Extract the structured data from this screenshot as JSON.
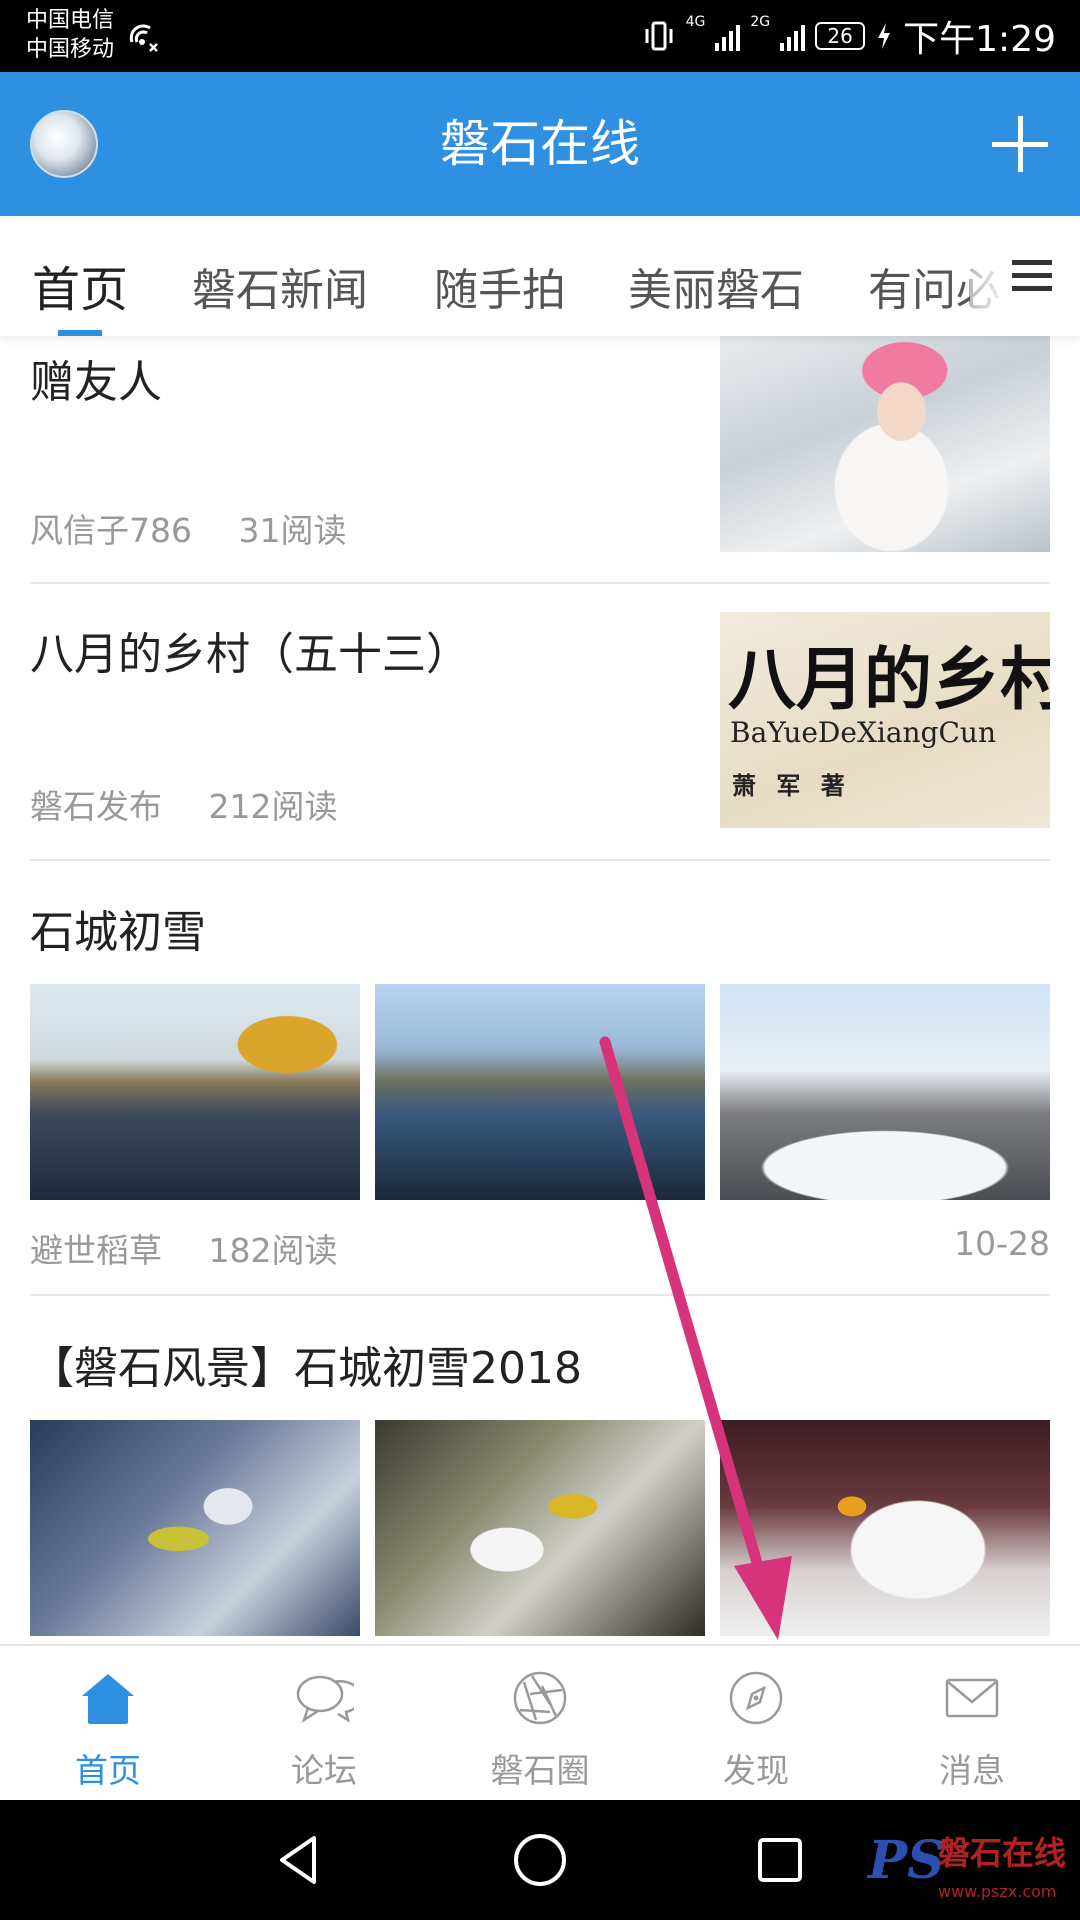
{
  "status_bar": {
    "carrier_1": "中国电信",
    "carrier_2": "中国移动",
    "network_1": "4G",
    "network_2": "2G",
    "battery": "26",
    "time": "下午1:29"
  },
  "header": {
    "title": "磐石在线"
  },
  "tabs": [
    {
      "label": "首页",
      "active": true
    },
    {
      "label": "磐石新闻",
      "active": false
    },
    {
      "label": "随手拍",
      "active": false
    },
    {
      "label": "美丽磐石",
      "active": false
    },
    {
      "label": "有问必",
      "active": false
    }
  ],
  "feed": {
    "items": [
      {
        "title": "赠友人",
        "author": "风信子786",
        "reads": "31阅读"
      },
      {
        "title": "八月的乡村（五十三）",
        "author": "磐石发布",
        "reads": "212阅读",
        "thumb_text": {
          "big": "八月的乡村",
          "pinyin": "BaYueDeXiangCun",
          "author": "萧 军 著"
        }
      },
      {
        "title": "石城初雪",
        "author": "避世稻草",
        "reads": "182阅读",
        "date": "10-28"
      },
      {
        "title": "【磐石风景】石城初雪2018"
      }
    ]
  },
  "bottom_nav": [
    {
      "label": "首页",
      "icon": "home-icon",
      "active": true
    },
    {
      "label": "论坛",
      "icon": "chat-icon",
      "active": false
    },
    {
      "label": "磐石圈",
      "icon": "aperture-icon",
      "active": false
    },
    {
      "label": "发现",
      "icon": "compass-icon",
      "active": false
    },
    {
      "label": "消息",
      "icon": "mail-icon",
      "active": false
    }
  ],
  "watermark": {
    "logo": "PS",
    "name": "磐石在线",
    "url": "www.pszx.com"
  },
  "colors": {
    "brand": "#2f8fe0",
    "annotation_arrow": "#d6337a"
  }
}
